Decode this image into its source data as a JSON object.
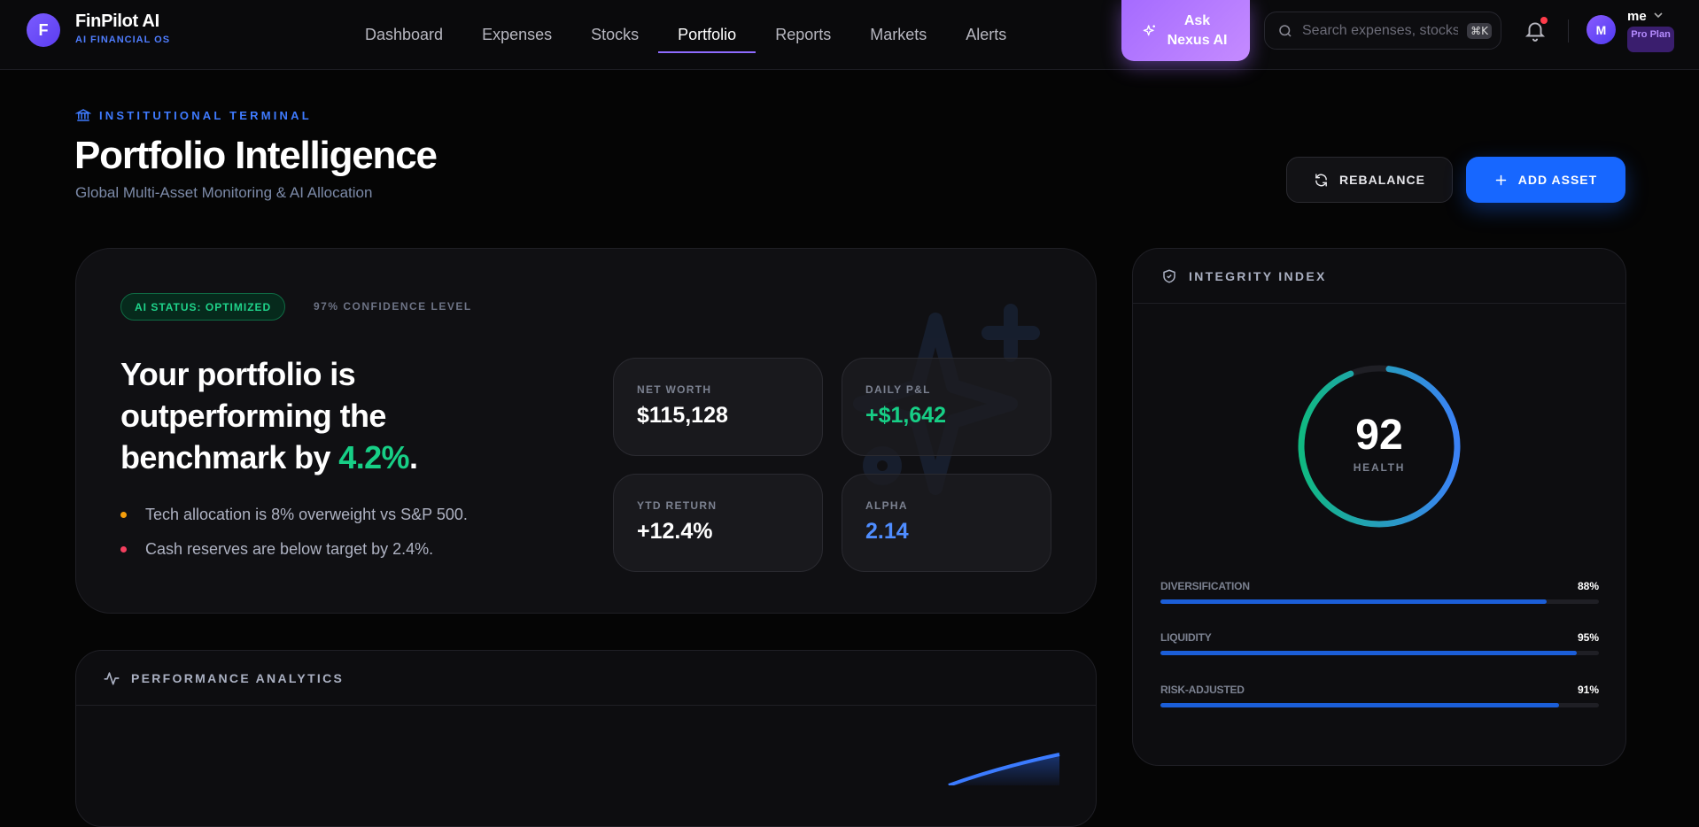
{
  "brand": {
    "initial": "F",
    "name": "FinPilot AI",
    "subtitle": "AI FINANCIAL OS"
  },
  "nav": {
    "links": [
      {
        "label": "Dashboard",
        "active": false
      },
      {
        "label": "Expenses",
        "active": false
      },
      {
        "label": "Stocks",
        "active": false
      },
      {
        "label": "Portfolio",
        "active": true
      },
      {
        "label": "Reports",
        "active": false
      },
      {
        "label": "Markets",
        "active": false
      },
      {
        "label": "Alerts",
        "active": false
      }
    ],
    "ask_label": "Ask Nexus AI",
    "search_placeholder": "Search expenses, stocks...",
    "search_shortcut": "⌘K",
    "user_initial": "M",
    "user_name": "me",
    "plan": "Pro Plan"
  },
  "header": {
    "eyebrow": "INSTITUTIONAL TERMINAL",
    "title": "Portfolio Intelligence",
    "subtitle": "Global Multi-Asset Monitoring & AI Allocation",
    "rebalance_label": "REBALANCE",
    "add_label": "ADD ASSET"
  },
  "ai_card": {
    "status": "AI STATUS: OPTIMIZED",
    "confidence": "97% CONFIDENCE LEVEL",
    "headline_prefix": "Your portfolio is outperforming the benchmark by ",
    "headline_value": "4.2%",
    "headline_suffix": ".",
    "insights": [
      {
        "text": "Tech allocation is 8% overweight vs S&P 500.",
        "color": "#f59e0b"
      },
      {
        "text": "Cash reserves are below target by 2.4%.",
        "color": "#f43f5e"
      }
    ],
    "metrics": [
      {
        "label": "NET WORTH",
        "value": "$115,128",
        "color": "#ffffff"
      },
      {
        "label": "DAILY P&L",
        "value": "+$1,642",
        "color": "#17cf86"
      },
      {
        "label": "YTD RETURN",
        "value": "+12.4%",
        "color": "#ffffff"
      },
      {
        "label": "ALPHA",
        "value": "2.14",
        "color": "#4f8dff"
      }
    ]
  },
  "performance": {
    "title": "PERFORMANCE ANALYTICS"
  },
  "integrity": {
    "title": "INTEGRITY INDEX",
    "score": "92",
    "score_label": "HEALTH",
    "score_fraction": 0.92,
    "bars": [
      {
        "label": "DIVERSIFICATION",
        "value": "88%",
        "fraction": 0.88
      },
      {
        "label": "LIQUIDITY",
        "value": "95%",
        "fraction": 0.95
      },
      {
        "label": "RISK-ADJUSTED",
        "value": "91%",
        "fraction": 0.91
      }
    ]
  },
  "colors": {
    "accent": "#1767ff",
    "brand": "#7b5cff",
    "positive": "#17cf86"
  }
}
